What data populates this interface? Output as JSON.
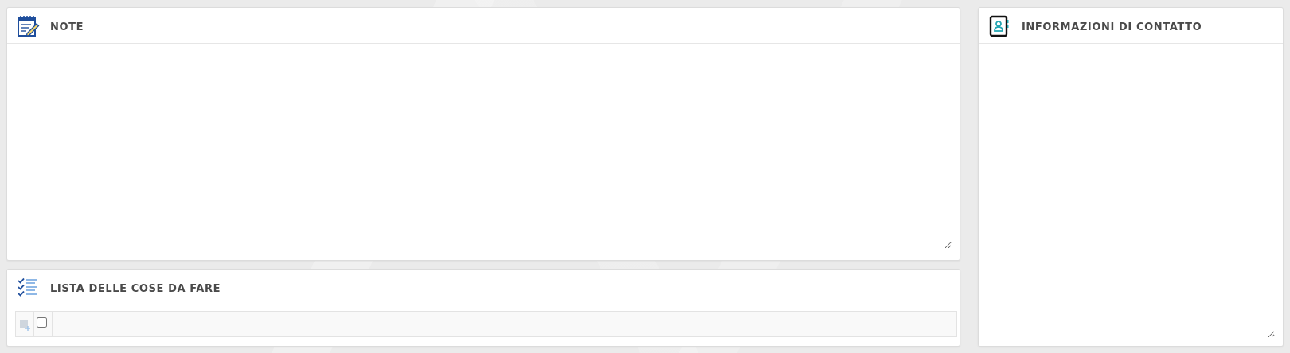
{
  "notes": {
    "title": "NOTE",
    "icon": "notepad-icon",
    "content": ""
  },
  "todo": {
    "title": "LISTA DELLE COSE DA FARE",
    "icon": "checklist-icon",
    "add_icon": "add-item-icon",
    "new_item_value": ""
  },
  "contact": {
    "title": "INFORMAZIONI DI CONTATTO",
    "icon": "address-book-icon",
    "content": ""
  },
  "colors": {
    "icon_blue": "#1f4e9c",
    "icon_teal": "#22a6b3",
    "title_text": "#4a4a4a",
    "background": "#ebebeb"
  }
}
